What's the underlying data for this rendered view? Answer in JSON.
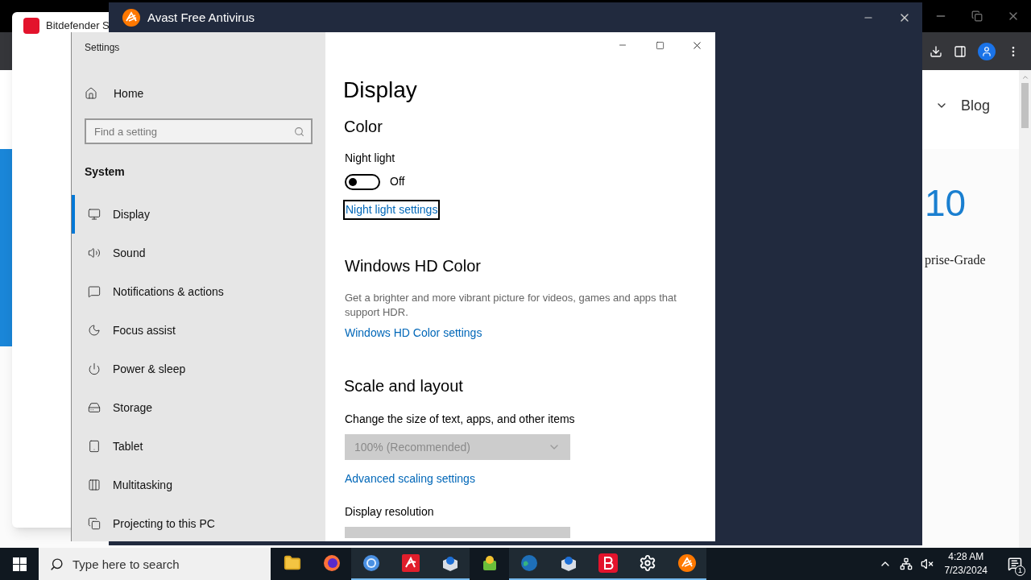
{
  "browser": {
    "nav_link": "Blog",
    "heading_fragment": "10",
    "text_fragment": "prise-Grade"
  },
  "bitdefender": {
    "title": "Bitdefender S"
  },
  "avast": {
    "title": "Avast Free Antivirus"
  },
  "settings": {
    "title": "Settings",
    "home": "Home",
    "search": {
      "placeholder": "Find a setting"
    },
    "section": "System",
    "nav": [
      {
        "label": "Display",
        "kind": "display",
        "selected": true
      },
      {
        "label": "Sound",
        "kind": "sound",
        "selected": false
      },
      {
        "label": "Notifications & actions",
        "kind": "notifications",
        "selected": false
      },
      {
        "label": "Focus assist",
        "kind": "moon",
        "selected": false
      },
      {
        "label": "Power & sleep",
        "kind": "power",
        "selected": false
      },
      {
        "label": "Storage",
        "kind": "storage",
        "selected": false
      },
      {
        "label": "Tablet",
        "kind": "tablet",
        "selected": false
      },
      {
        "label": "Multitasking",
        "kind": "multitasking",
        "selected": false
      },
      {
        "label": "Projecting to this PC",
        "kind": "projecting",
        "selected": false
      }
    ],
    "page": {
      "title": "Display",
      "color_heading": "Color",
      "night_light": {
        "label": "Night light",
        "on": false,
        "state_text": "Off"
      },
      "night_light_link": "Night light settings",
      "hd_heading": "Windows HD Color",
      "hd_description": "Get a brighter and more vibrant picture for videos, games and apps that support HDR.",
      "hd_link": "Windows HD Color settings",
      "scale_heading": "Scale and layout",
      "scale_label": "Change the size of text, apps, and other items",
      "scale_dropdown": {
        "value": "100% (Recommended)",
        "disabled": true
      },
      "advanced_link": "Advanced scaling settings",
      "resolution_label": "Display resolution",
      "resolution_dropdown": {
        "disabled": true
      }
    }
  },
  "taskbar": {
    "search": {
      "placeholder": "Type here to search"
    },
    "apps": [
      {
        "kind": "folder",
        "running": false
      },
      {
        "kind": "firefox",
        "running": false
      },
      {
        "kind": "chrome",
        "running": true
      },
      {
        "kind": "avira",
        "running": true
      },
      {
        "kind": "malwarebytes",
        "running": true
      },
      {
        "kind": "installer",
        "running": false
      },
      {
        "kind": "globe",
        "running": true
      },
      {
        "kind": "malwarebytes",
        "running": true
      },
      {
        "kind": "bitdefender",
        "running": true
      },
      {
        "kind": "settings",
        "running": true
      },
      {
        "kind": "avast",
        "running": true
      }
    ],
    "time": "4:28 AM",
    "date": "7/23/2024",
    "notifications": "1"
  }
}
